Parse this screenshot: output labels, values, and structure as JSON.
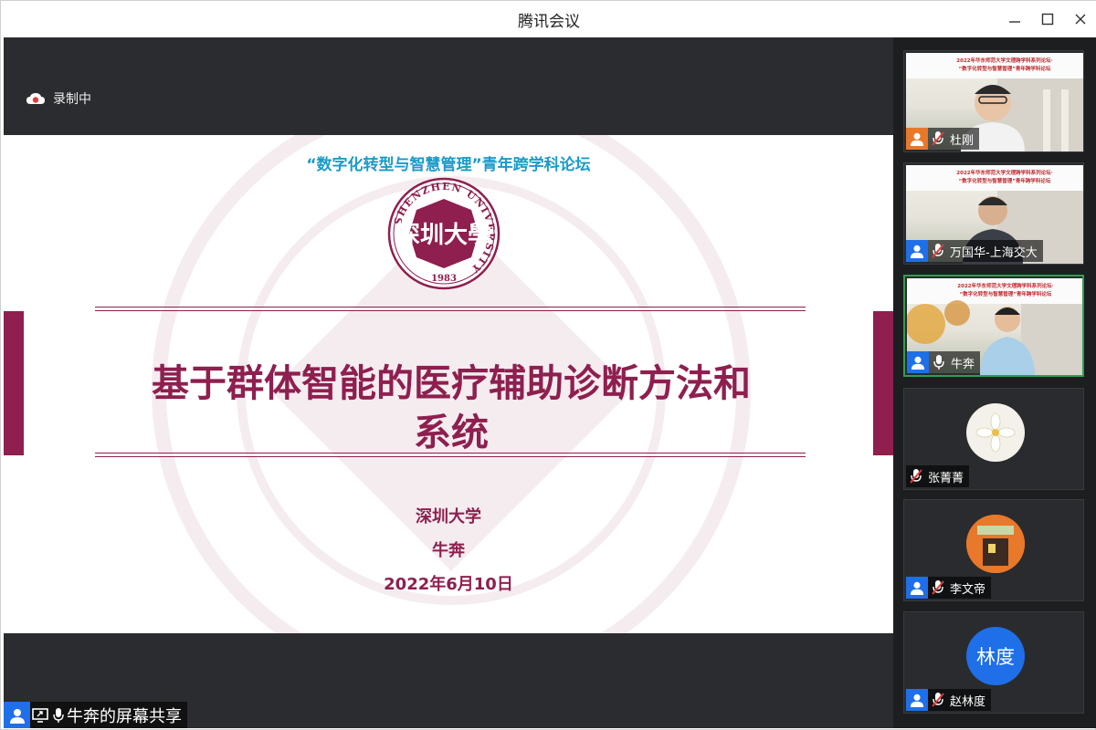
{
  "window": {
    "title": "腾讯会议"
  },
  "recording": {
    "label": "录制中"
  },
  "slide": {
    "forum": "“数字化转型与智慧管理”青年跨学科论坛",
    "logo_ring": "SHENZHEN UNIVERSITY",
    "logo_year": "1983",
    "logo_chars": "深圳大學",
    "title_line1": "基于群体智能的医疗辅助诊断方法和",
    "title_line2": "系统",
    "institution": "深圳大学",
    "presenter": "牛奔",
    "date": "2022年6月10日",
    "brand_color": "#8e1f4f",
    "forum_color": "#1a9ac9"
  },
  "share": {
    "label": "牛奔的屏幕共享"
  },
  "participants": [
    {
      "name": "杜刚",
      "mic": "muted",
      "video": true,
      "avatar": "orange"
    },
    {
      "name": "万国华-上海交大",
      "mic": "muted",
      "video": true,
      "avatar": "blue"
    },
    {
      "name": "牛奔",
      "mic": "on",
      "video": true,
      "avatar": "blue",
      "active": true
    },
    {
      "name": "张菁菁",
      "mic": "muted",
      "video": false,
      "avatar": "flower"
    },
    {
      "name": "李文帝",
      "mic": "muted",
      "video": false,
      "avatar": "photo"
    },
    {
      "name": "赵林度",
      "mic": "muted",
      "video": false,
      "avatar": "initials",
      "initials": "林度"
    }
  ],
  "video_banner": {
    "line1": "2022年华东师范大学文理跨学科系列论坛·",
    "line2": "“数字化转型与智慧管理”青年跨学科论坛"
  }
}
